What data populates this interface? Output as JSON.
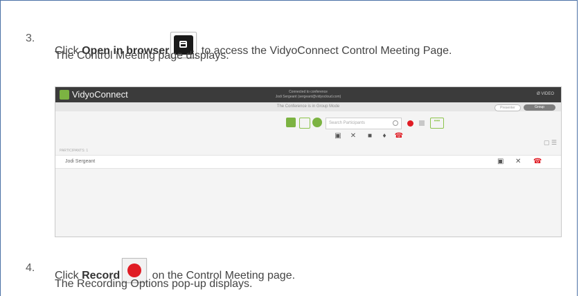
{
  "steps": [
    {
      "number": "3.",
      "line1_pre": "Click ",
      "line1_bold": "Open in browser",
      "line1_post": " to access the VidyoConnect Control Meeting Page.",
      "line2": "The Control Meeting page displays.",
      "icon": "open-in-browser-icon"
    },
    {
      "number": "4.",
      "line1_pre": "Click ",
      "line1_bold": "Record",
      "line1_post": " on the Control Meeting page.",
      "line2": "The Recording Options pop-up displays.",
      "icon": "record-icon"
    }
  ],
  "screenshot": {
    "app_name": "VidyoConnect",
    "connection_line1": "Connected to conference",
    "connection_line2": "Jodi Sergeant (sergeant@vidyocloud.com)",
    "right_status": "Ø VIDEO",
    "mode_text": "The Conference is in Group Mode",
    "mode_option1": "Presenter",
    "mode_option2": "Group",
    "search_placeholder": "Search Participants",
    "more_label": "•••",
    "participants_header": "PARTICIPANTS: 1",
    "participants": [
      {
        "name": "Jodi Sergeant"
      }
    ],
    "colors": {
      "record": "#e01c24",
      "accent": "#8bc34a",
      "topbar": "#3b3b3b"
    }
  }
}
